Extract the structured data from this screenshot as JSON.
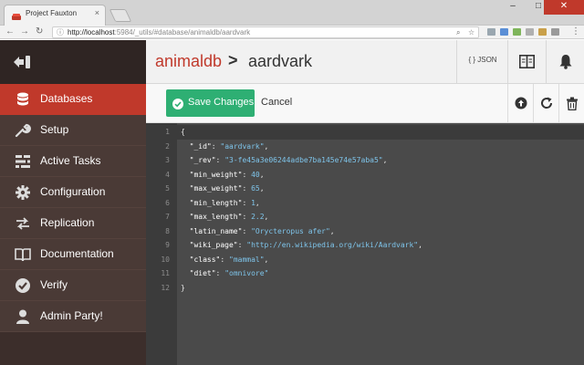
{
  "browser": {
    "tab_title": "Project Fauxton",
    "tab_close": "×",
    "url_host": "http://localhost",
    "url_rest": ":5984/_utils/#database/animaldb/aardvark"
  },
  "sidebar": {
    "items": [
      {
        "label": "Databases",
        "icon": "database-icon",
        "active": true
      },
      {
        "label": "Setup",
        "icon": "wrench-icon"
      },
      {
        "label": "Active Tasks",
        "icon": "tasks-icon"
      },
      {
        "label": "Configuration",
        "icon": "gear-icon"
      },
      {
        "label": "Replication",
        "icon": "replication-icon"
      },
      {
        "label": "Documentation",
        "icon": "book-icon"
      },
      {
        "label": "Verify",
        "icon": "check-icon"
      },
      {
        "label": "Admin Party!",
        "icon": "user-icon"
      }
    ]
  },
  "header": {
    "database": "animaldb",
    "separator": ">",
    "document": "aardvark",
    "json_label": "{ } JSON"
  },
  "actions": {
    "save_label": "Save Changes",
    "cancel_label": "Cancel"
  },
  "editor": {
    "lines": [
      {
        "n": "1",
        "text": "{"
      },
      {
        "n": "2",
        "key": "\"_id\"",
        "value": "\"aardvark\"",
        "type": "string",
        "comma": ","
      },
      {
        "n": "3",
        "key": "\"_rev\"",
        "value": "\"3-fe45a3e06244adbe7ba145e74e57aba5\"",
        "type": "string",
        "comma": ","
      },
      {
        "n": "4",
        "key": "\"min_weight\"",
        "value": "40",
        "type": "number",
        "comma": ","
      },
      {
        "n": "5",
        "key": "\"max_weight\"",
        "value": "65",
        "type": "number",
        "comma": ","
      },
      {
        "n": "6",
        "key": "\"min_length\"",
        "value": "1",
        "type": "number",
        "comma": ","
      },
      {
        "n": "7",
        "key": "\"max_length\"",
        "value": "2.2",
        "type": "number",
        "comma": ","
      },
      {
        "n": "8",
        "key": "\"latin_name\"",
        "value": "\"Orycteropus afer\"",
        "type": "string",
        "comma": ","
      },
      {
        "n": "9",
        "key": "\"wiki_page\"",
        "value": "\"http://en.wikipedia.org/wiki/Aardvark\"",
        "type": "string",
        "comma": ","
      },
      {
        "n": "10",
        "key": "\"class\"",
        "value": "\"mammal\"",
        "type": "string",
        "comma": ","
      },
      {
        "n": "11",
        "key": "\"diet\"",
        "value": "\"omnivore\"",
        "type": "string",
        "comma": ""
      },
      {
        "n": "12",
        "text": "}"
      }
    ]
  },
  "colors": {
    "brand_red": "#c0392b",
    "save_green": "#2eaf73",
    "sidebar_bg": "#4a3a36",
    "editor_bg": "#4a4a4a"
  }
}
